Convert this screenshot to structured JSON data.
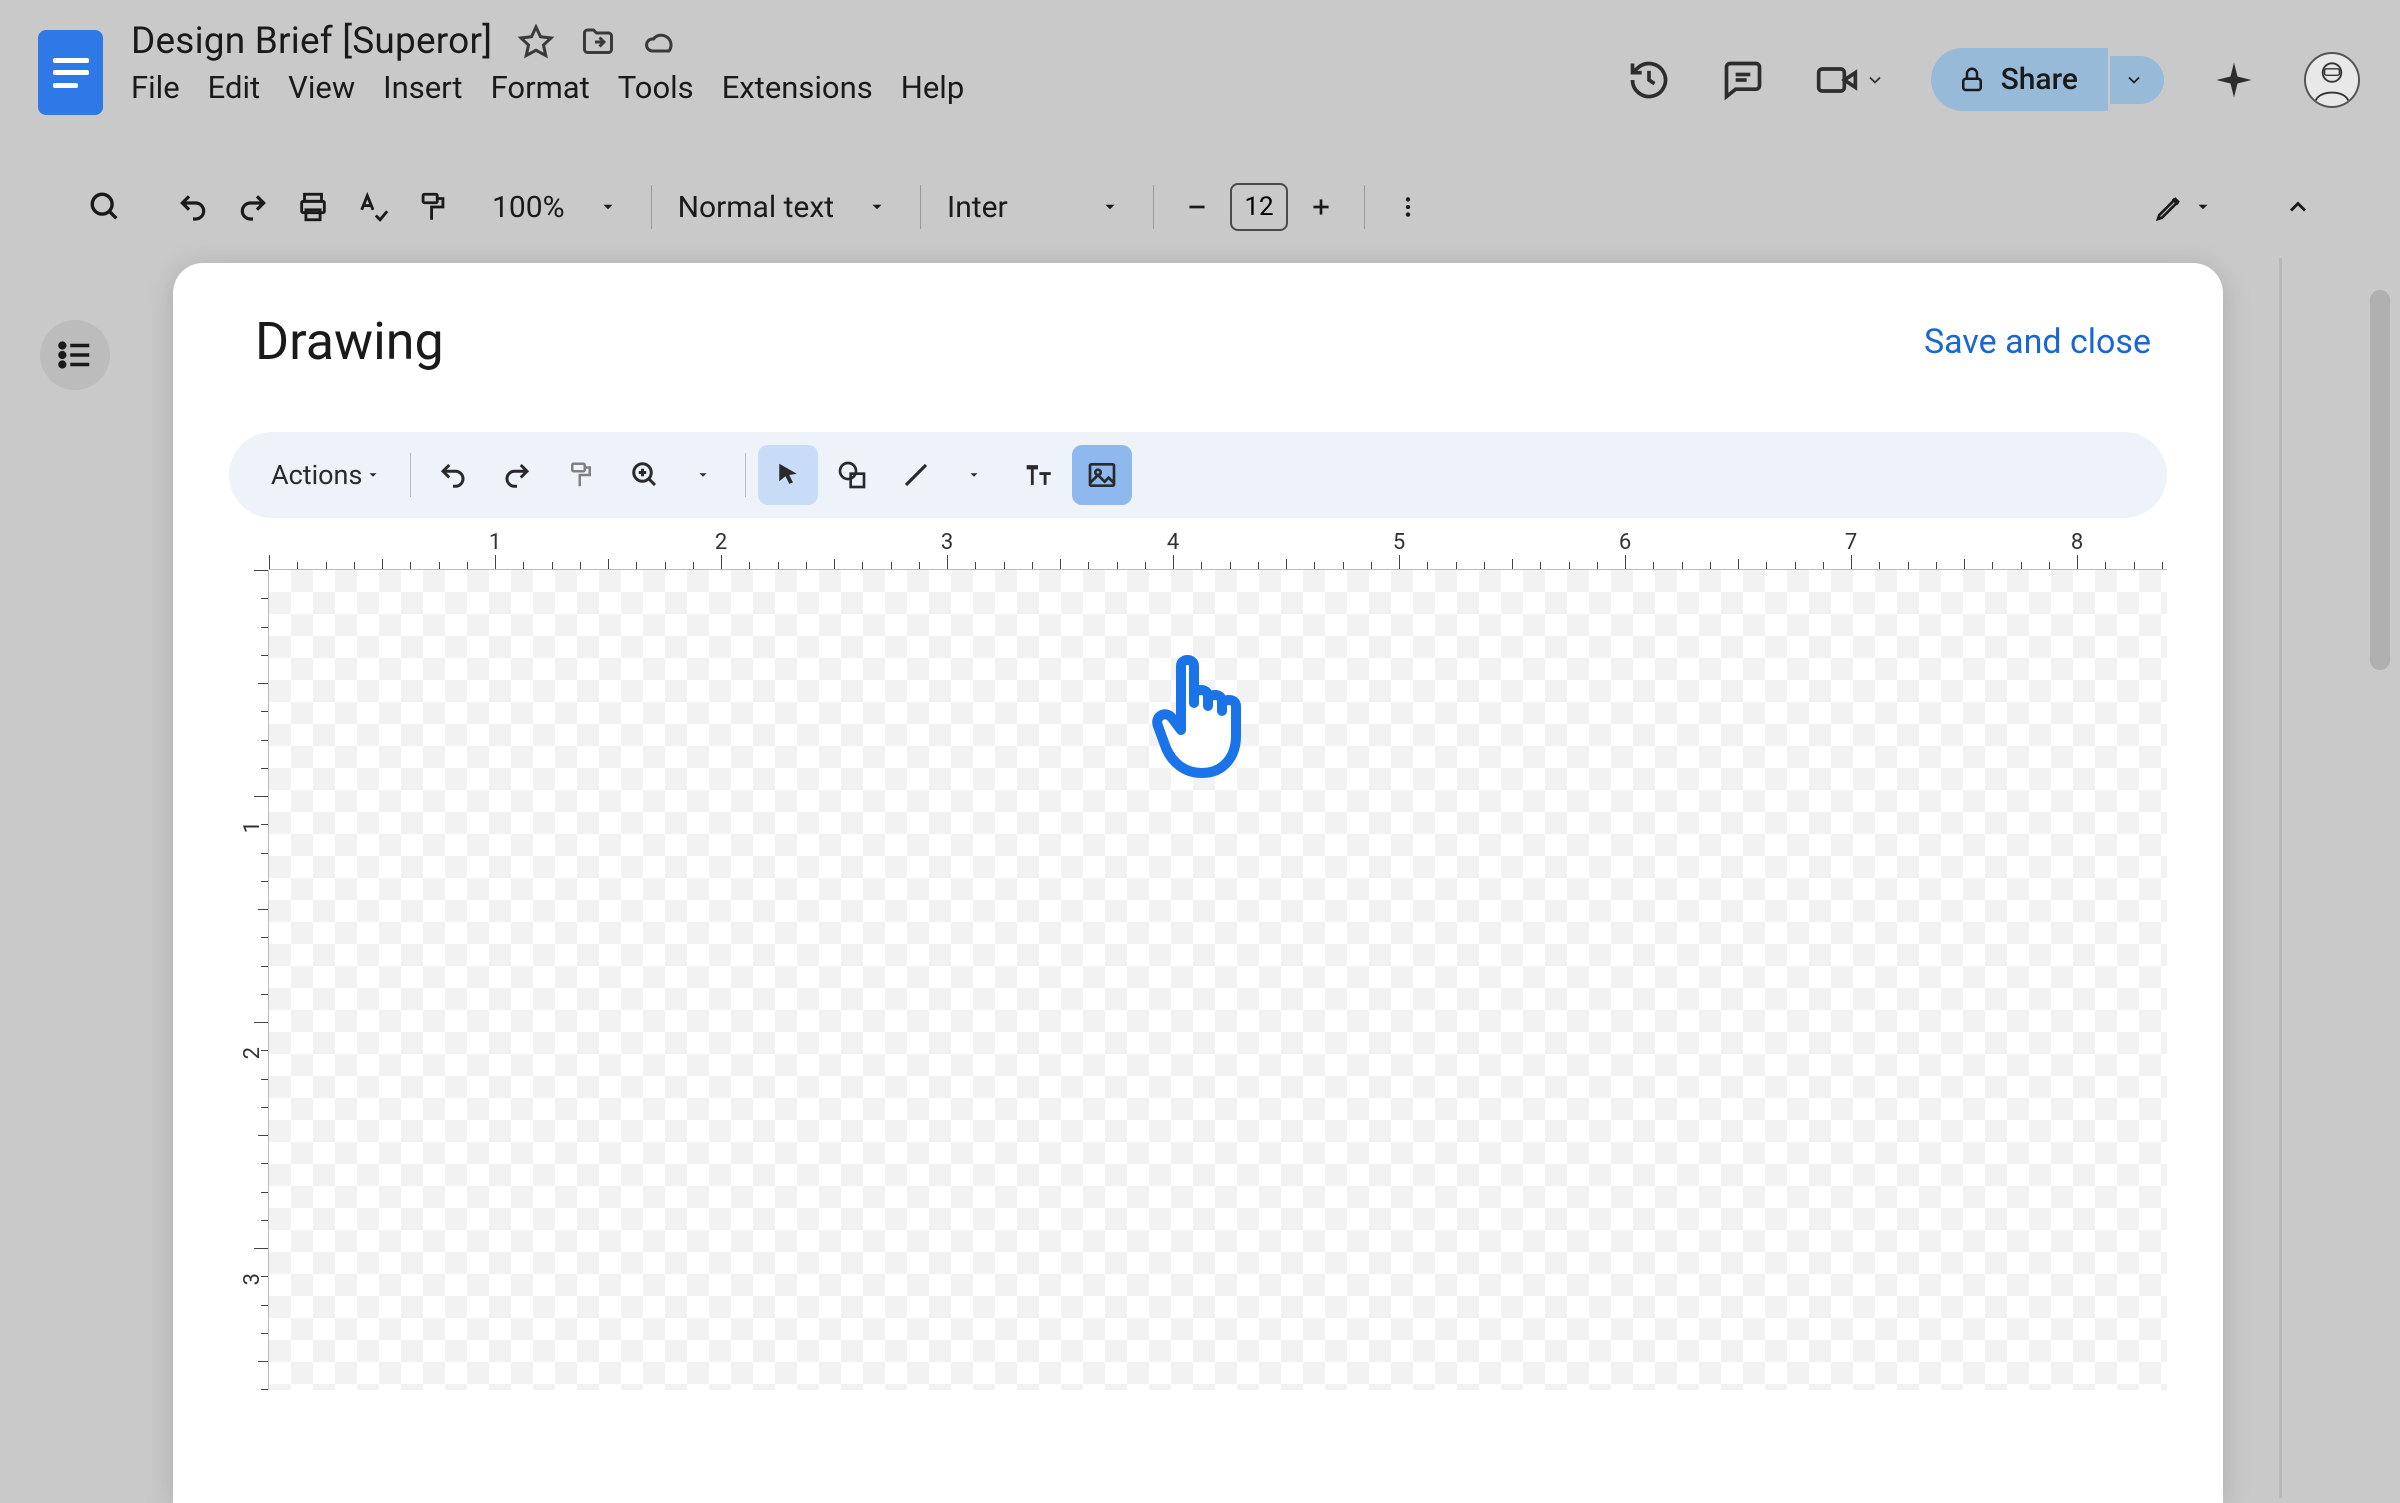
{
  "doc": {
    "title": "Design Brief [Superor]"
  },
  "menus": [
    "File",
    "Edit",
    "View",
    "Insert",
    "Format",
    "Tools",
    "Extensions",
    "Help"
  ],
  "toolbar": {
    "zoom": "100%",
    "paragraph_style": "Normal text",
    "font": "Inter",
    "font_size": "12"
  },
  "share": {
    "label": "Share"
  },
  "modal": {
    "title": "Drawing",
    "save_close": "Save and close"
  },
  "drawing_toolbar": {
    "actions_label": "Actions"
  },
  "ruler": {
    "h_numbers": [
      "1",
      "2",
      "3",
      "4",
      "5",
      "6",
      "7",
      "8"
    ],
    "v_numbers": [
      "1",
      "2",
      "3"
    ]
  }
}
